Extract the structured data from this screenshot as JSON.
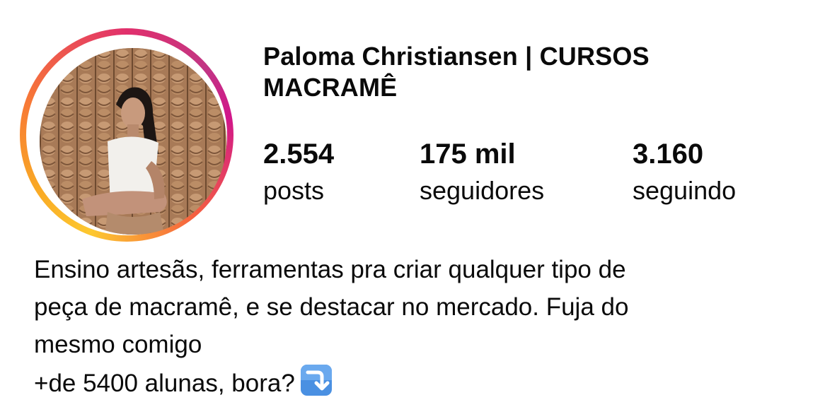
{
  "profile": {
    "name": "Paloma Christiansen | CURSOS MACRAMÊ",
    "avatar_icon": "profile-photo",
    "ring_colors": [
      "#fdc830",
      "#f77737",
      "#e1306c",
      "#c13584"
    ]
  },
  "stats": [
    {
      "value": "2.554",
      "label": "posts"
    },
    {
      "value": "175 mil",
      "label": "seguidores"
    },
    {
      "value": "3.160",
      "label": "seguindo"
    }
  ],
  "bio": {
    "lines": [
      "Ensino artesãs, ferramentas pra criar qualquer tipo de",
      "peça de macramê, e se destacar no mercado. Fuja do",
      "mesmo comigo",
      "+de 5400 alunas, bora?"
    ],
    "emoji_icon": "arrow-down-right-icon",
    "emoji_color": "#4a90e2"
  }
}
